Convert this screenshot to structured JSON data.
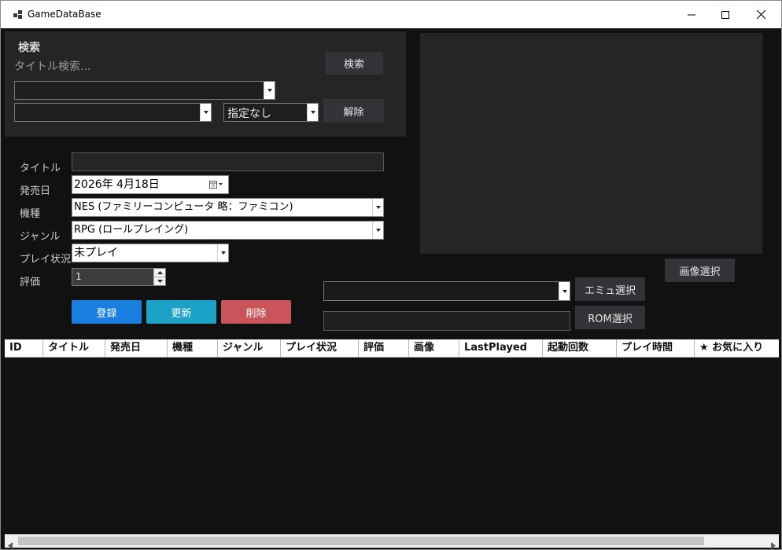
{
  "window": {
    "title": "GameDataBase",
    "controls": [
      "minimize-icon",
      "maximize-icon",
      "close-icon"
    ]
  },
  "search": {
    "heading": "検索",
    "placeholder": "タイトル検索...",
    "search_button": "検索",
    "combo1_value": "",
    "combo2_value": "",
    "combo3_value": "指定なし",
    "clear_button": "解除"
  },
  "form": {
    "title_label": "タイトル",
    "title_value": "",
    "release_label": "発売日",
    "release_value": "2026年  4月18日",
    "platform_label": "機種",
    "platform_value": "NES (ファミリーコンピュータ 略：ファミコン)",
    "genre_label": "ジャンル",
    "genre_value": "RPG (ロールプレイング)",
    "status_label": "プレイ状況",
    "status_value": "未プレイ",
    "rating_label": "評価",
    "rating_value": "1"
  },
  "actions": {
    "register": "登録",
    "update": "更新",
    "delete": "削除",
    "image_select": "画像選択",
    "emu_select": "エミュ選択",
    "rom_select": "ROM選択",
    "emu_value": "",
    "rom_value": ""
  },
  "grid": {
    "columns": [
      "ID",
      "タイトル",
      "発売日",
      "機種",
      "ジャンル",
      "プレイ状況",
      "評価",
      "画像",
      "LastPlayed",
      "起動回数",
      "プレイ時間",
      "★ お気に入り"
    ],
    "rows": []
  },
  "colors": {
    "background": "#111111",
    "panel": "#252526",
    "register": "#1a7ee0",
    "update": "#1ba2c6",
    "delete": "#c9545a"
  }
}
